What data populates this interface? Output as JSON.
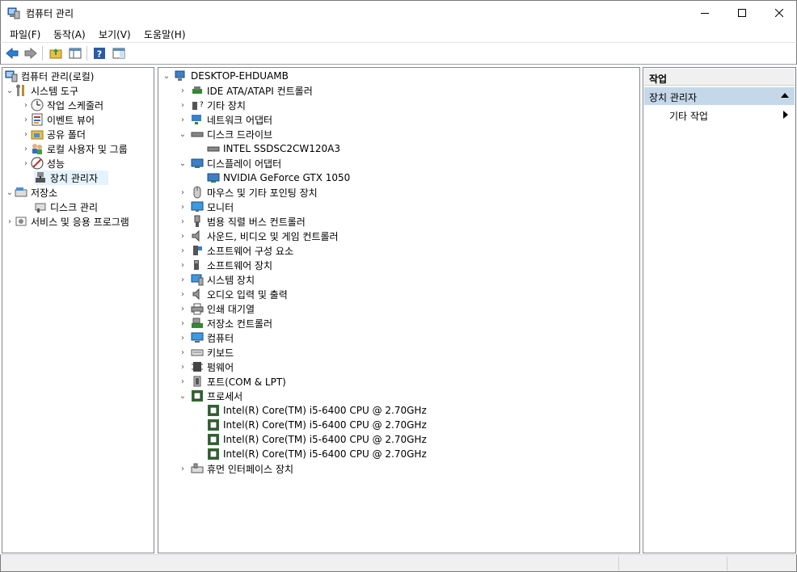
{
  "window": {
    "title": "컴퓨터 관리"
  },
  "menu": [
    "파일(F)",
    "동작(A)",
    "보기(V)",
    "도움말(H)"
  ],
  "left_tree": [
    {
      "label": "컴퓨터 관리(로컬)",
      "icon": "computer-management-icon"
    },
    {
      "label": "시스템 도구",
      "icon": "tools-icon"
    },
    {
      "label": "작업 스케줄러",
      "icon": "clock-icon"
    },
    {
      "label": "이벤트 뷰어",
      "icon": "event-viewer-icon"
    },
    {
      "label": "공유 폴더",
      "icon": "shared-folder-icon"
    },
    {
      "label": "로컬 사용자 및 그룹",
      "icon": "users-icon"
    },
    {
      "label": "성능",
      "icon": "performance-icon"
    },
    {
      "label": "장치 관리자",
      "icon": "device-manager-icon"
    },
    {
      "label": "저장소",
      "icon": "storage-icon"
    },
    {
      "label": "디스크 관리",
      "icon": "disk-management-icon"
    },
    {
      "label": "서비스 및 응용 프로그램",
      "icon": "services-icon"
    }
  ],
  "device_tree": [
    {
      "label": "DESKTOP-EHDUAMB",
      "icon": "computer-icon"
    },
    {
      "label": "IDE ATA/ATAPI 컨트롤러",
      "icon": "ide-controller-icon"
    },
    {
      "label": "기타 장치",
      "icon": "unknown-device-icon"
    },
    {
      "label": "네트워크 어댑터",
      "icon": "network-adapter-icon"
    },
    {
      "label": "디스크 드라이브",
      "icon": "disk-drive-icon"
    },
    {
      "label": "INTEL SSDSC2CW120A3",
      "icon": "disk-drive-icon"
    },
    {
      "label": "디스플레이 어댑터",
      "icon": "display-adapter-icon"
    },
    {
      "label": "NVIDIA GeForce GTX 1050",
      "icon": "display-adapter-icon"
    },
    {
      "label": "마우스 및 기타 포인팅 장치",
      "icon": "mouse-icon"
    },
    {
      "label": "모니터",
      "icon": "monitor-icon"
    },
    {
      "label": "범용 직렬 버스 컨트롤러",
      "icon": "usb-icon"
    },
    {
      "label": "사운드, 비디오 및 게임 컨트롤러",
      "icon": "speaker-icon"
    },
    {
      "label": "소프트웨어 구성 요소",
      "icon": "software-component-icon"
    },
    {
      "label": "소프트웨어 장치",
      "icon": "software-device-icon"
    },
    {
      "label": "시스템 장치",
      "icon": "system-device-icon"
    },
    {
      "label": "오디오 입력 및 출력",
      "icon": "audio-icon"
    },
    {
      "label": "인쇄 대기열",
      "icon": "printer-icon"
    },
    {
      "label": "저장소 컨트롤러",
      "icon": "storage-controller-icon"
    },
    {
      "label": "컴퓨터",
      "icon": "computer-icon"
    },
    {
      "label": "키보드",
      "icon": "keyboard-icon"
    },
    {
      "label": "펌웨어",
      "icon": "firmware-icon"
    },
    {
      "label": "포트(COM & LPT)",
      "icon": "port-icon"
    },
    {
      "label": "프로세서",
      "icon": "processor-icon"
    },
    {
      "label": "Intel(R) Core(TM) i5-6400 CPU @ 2.70GHz",
      "icon": "processor-icon"
    },
    {
      "label": "Intel(R) Core(TM) i5-6400 CPU @ 2.70GHz",
      "icon": "processor-icon"
    },
    {
      "label": "Intel(R) Core(TM) i5-6400 CPU @ 2.70GHz",
      "icon": "processor-icon"
    },
    {
      "label": "Intel(R) Core(TM) i5-6400 CPU @ 2.70GHz",
      "icon": "processor-icon"
    },
    {
      "label": "휴먼 인터페이스 장치",
      "icon": "hid-icon"
    }
  ],
  "actions": {
    "header": "작업",
    "section": "장치 관리자",
    "item": "기타 작업"
  }
}
